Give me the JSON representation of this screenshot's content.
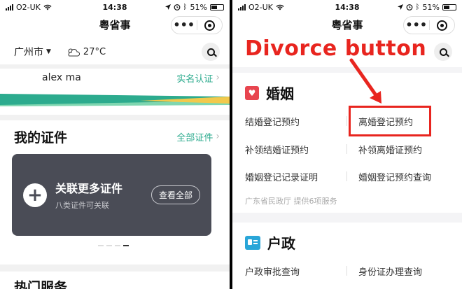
{
  "status_bar": {
    "carrier": "O2-UK",
    "time": "14:38",
    "battery": "51%"
  },
  "nav": {
    "title": "粤省事",
    "more": "•••"
  },
  "left": {
    "city": "广州市",
    "temperature": "27°C",
    "user_name": "alex ma",
    "realname_link": "实名认证",
    "certs_title": "我的证件",
    "certs_link": "全部证件",
    "card_title": "关联更多证件",
    "card_subtitle": "八类证件可关联",
    "card_button": "查看全部",
    "hot_title": "热门服务"
  },
  "right": {
    "annotation": "Divorce button",
    "marriage": {
      "title": "婚姻",
      "services": [
        "结婚登记预约",
        "离婚登记预约",
        "补领结婚证预约",
        "补领离婚证预约",
        "婚姻登记记录证明",
        "婚姻登记预约查询"
      ],
      "provider": "广东省民政厅  提供6项服务"
    },
    "household": {
      "title": "户政",
      "services": [
        "户政审批查询",
        "身份证办理查询"
      ]
    }
  },
  "colors": {
    "accent_green": "#2cab8e",
    "annotation_red": "#e8251f",
    "card_bg": "#4a4c56",
    "heart_red": "#e8454f",
    "id_blue": "#2aa6d8"
  },
  "icons": [
    "wifi-icon",
    "alarm-icon",
    "bluetooth-icon",
    "battery-icon",
    "more-dots-icon",
    "target-icon",
    "search-icon",
    "weather-cloud-icon",
    "chevron-right-icon",
    "plus-icon",
    "heart-icon",
    "id-card-icon",
    "arrow-icon"
  ]
}
